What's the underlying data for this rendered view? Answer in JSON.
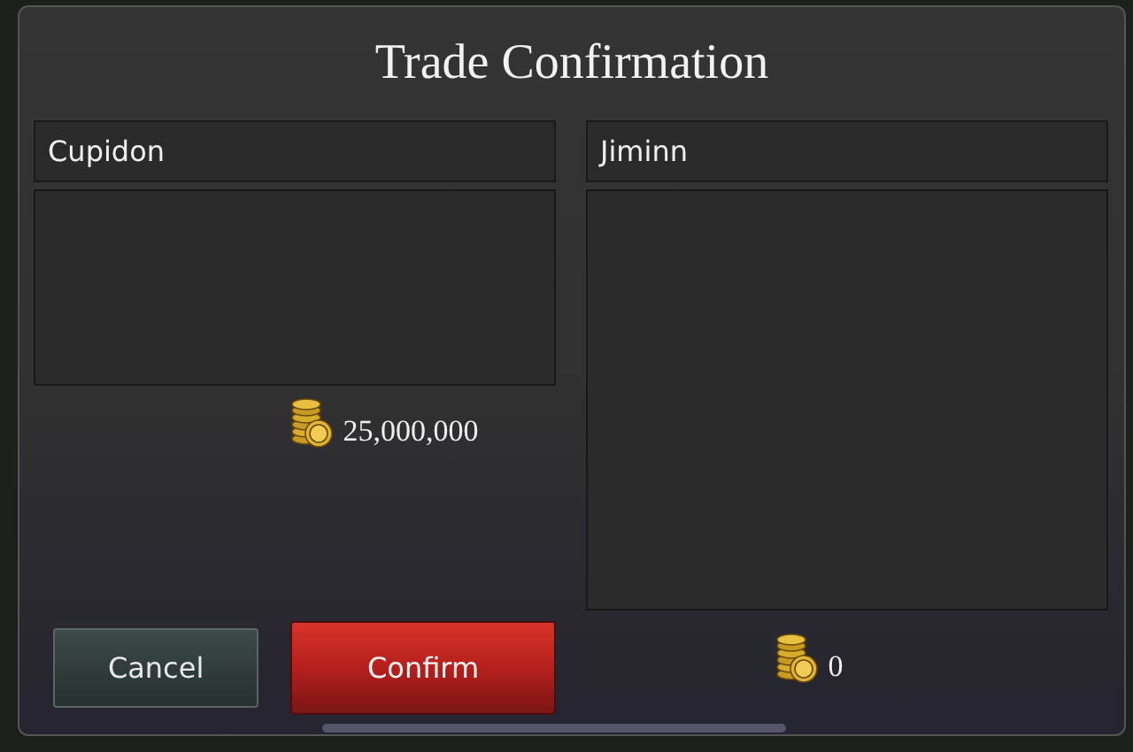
{
  "dialog": {
    "title": "Trade Confirmation"
  },
  "parties": [
    {
      "name": "Cupidon",
      "gold": "25,000,000"
    },
    {
      "name": "Jiminn",
      "gold": "0"
    }
  ],
  "buttons": [
    {
      "label": "Cancel",
      "kind": "secondary"
    },
    {
      "label": "Confirm",
      "kind": "primary"
    }
  ]
}
